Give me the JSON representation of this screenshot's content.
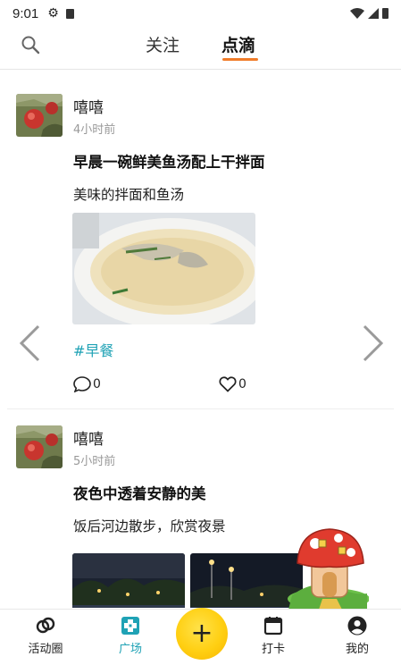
{
  "status_bar": {
    "time": "9:01"
  },
  "header": {
    "tabs": [
      {
        "label": "关注",
        "active": false
      },
      {
        "label": "点滴",
        "active": true
      }
    ]
  },
  "posts": [
    {
      "username": "嘻嘻",
      "time_ago": "4小时前",
      "title": "早晨一碗鲜美鱼汤配上干拌面",
      "description": "美味的拌面和鱼汤",
      "hashtag": "#早餐",
      "comments": "0",
      "likes": "0"
    },
    {
      "username": "嘻嘻",
      "time_ago": "5小时前",
      "title": "夜色中透着安静的美",
      "description": "饭后河边散步，欣赏夜景"
    }
  ],
  "bottom_nav": {
    "items": [
      {
        "label": "活动圈",
        "icon": "rings-icon"
      },
      {
        "label": "广场",
        "icon": "square-icon",
        "active": true
      },
      {
        "label": "打卡",
        "icon": "calendar-icon"
      },
      {
        "label": "我的",
        "icon": "user-icon"
      }
    ],
    "fab_label": "+"
  },
  "colors": {
    "accent": "#1fa2b5",
    "tab_underline": "#f07c2a",
    "fab": "#ffcf12"
  }
}
